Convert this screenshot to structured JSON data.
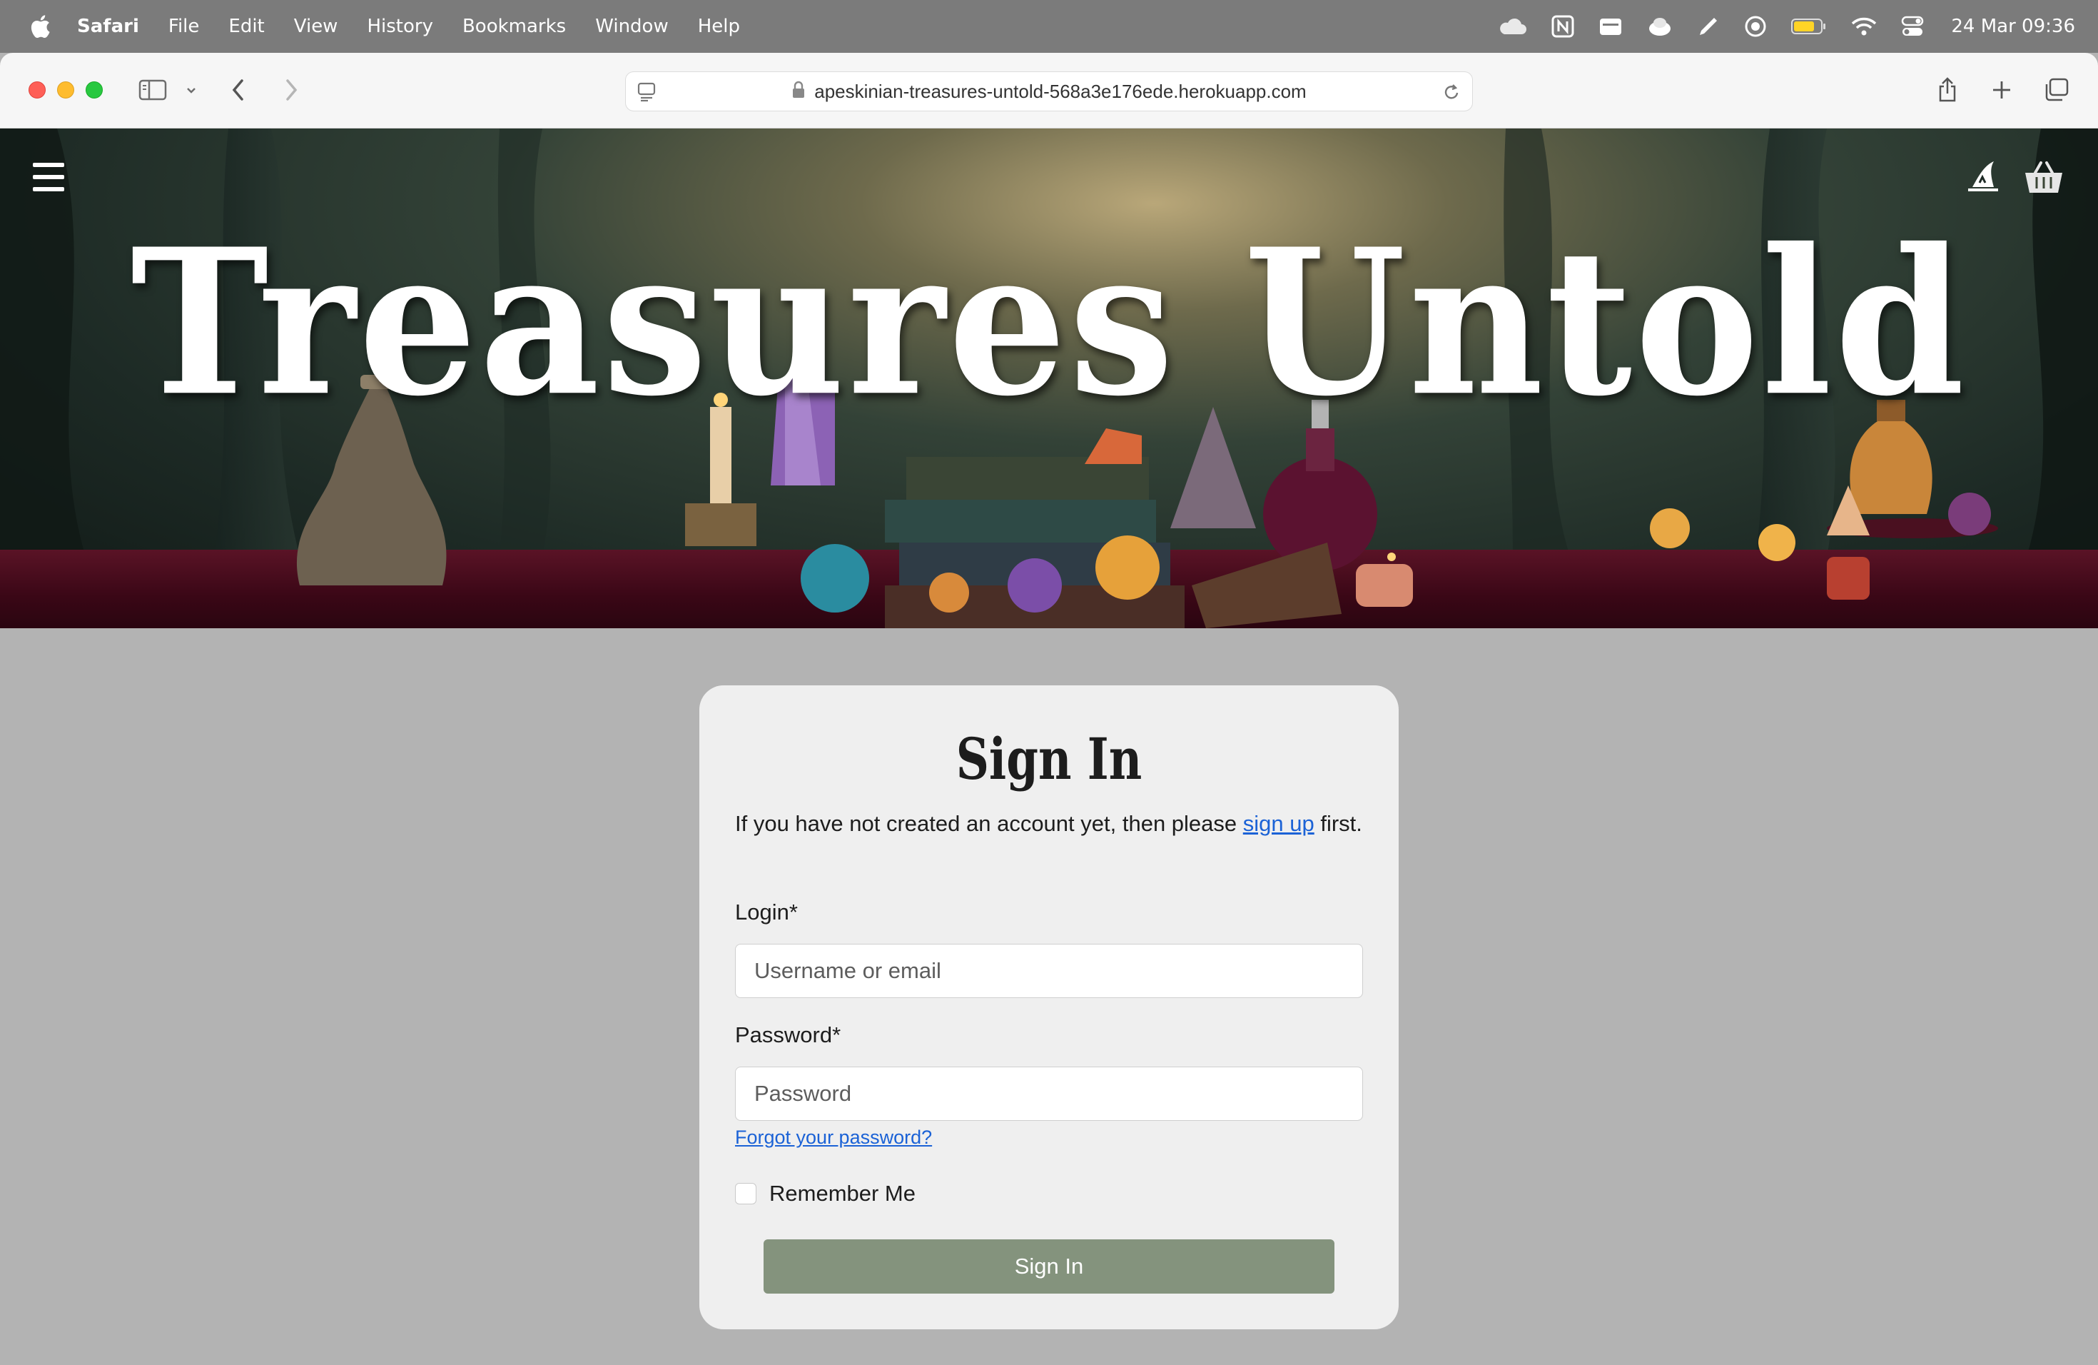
{
  "menubar": {
    "app_name": "Safari",
    "items": [
      "File",
      "Edit",
      "View",
      "History",
      "Bookmarks",
      "Window",
      "Help"
    ],
    "clock": "24 Mar  09:36"
  },
  "browser": {
    "url": "apeskinian-treasures-untold-568a3e176ede.herokuapp.com"
  },
  "site": {
    "title": "Treasures Untold"
  },
  "signin": {
    "heading": "Sign In",
    "intro_before": "If you have not created an account yet, then please ",
    "signup_link": "sign up",
    "intro_after": " first.",
    "login_label": "Login*",
    "login_placeholder": "Username or email",
    "password_label": "Password*",
    "password_placeholder": "Password",
    "forgot_link": "Forgot your password?",
    "remember_label": "Remember Me",
    "submit_label": "Sign In"
  },
  "colors": {
    "submit_bg": "#84937d",
    "link": "#1b62d6",
    "page_bg": "#b3b3b3",
    "card_bg": "#efefef"
  }
}
